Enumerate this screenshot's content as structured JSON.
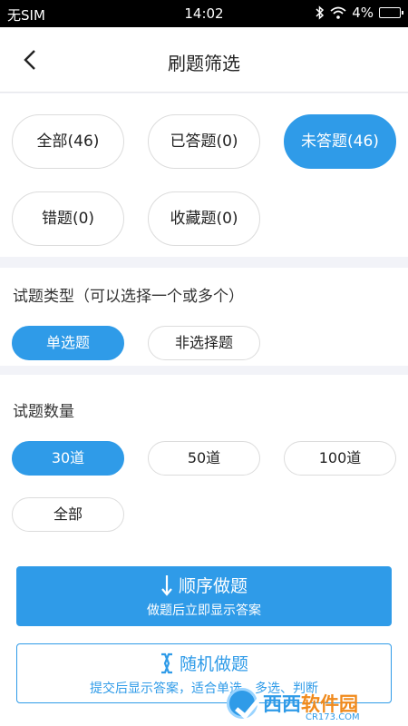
{
  "status_bar": {
    "carrier": "无SIM",
    "time": "14:02",
    "battery": "4%"
  },
  "header": {
    "title": "刷题筛选"
  },
  "answer_filter": {
    "all": "全部(46)",
    "answered": "已答题(0)",
    "unanswered": "未答题(46)",
    "wrong": "错题(0)",
    "favorites": "收藏题(0)",
    "selected": "unanswered"
  },
  "question_type": {
    "label": "试题类型（可以选择一个或多个）",
    "single": "单选题",
    "non_choice": "非选择题",
    "selected": "single"
  },
  "question_count": {
    "label": "试题数量",
    "c30": "30道",
    "c50": "50道",
    "c100": "100道",
    "all": "全部",
    "selected": "30"
  },
  "actions": {
    "order_title": "顺序做题",
    "order_sub": "做题后立即显示答案",
    "random_title": "随机做题",
    "random_sub": "提交后显示答案，适合单选、多选、判断"
  },
  "watermark": {
    "brand_a": "西西",
    "brand_b": "软件园",
    "url": "CR173.COM"
  },
  "colors": {
    "accent": "#2f9be8",
    "watermark_orange": "#f08a1c"
  }
}
